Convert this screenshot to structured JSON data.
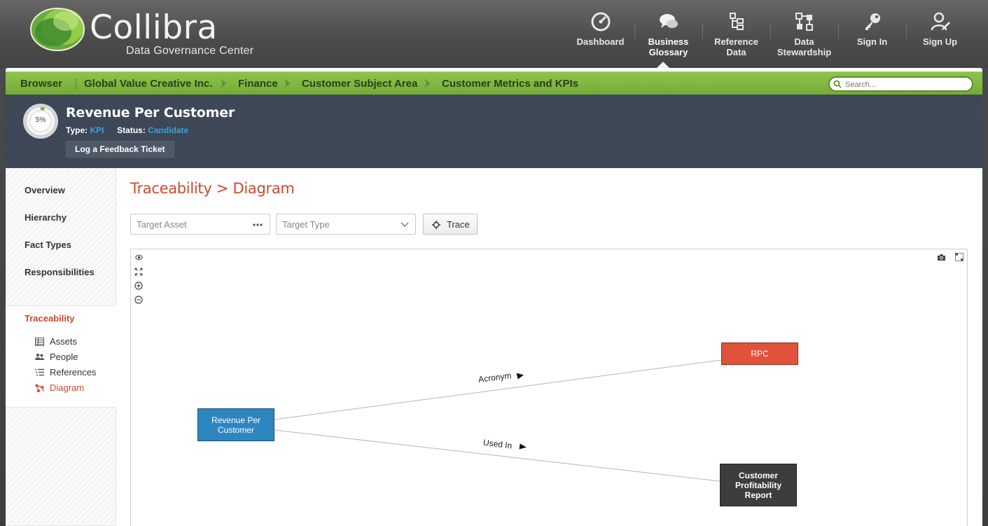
{
  "app": {
    "brand": "Collibra",
    "subtitle": "Data Governance Center"
  },
  "nav": {
    "items": [
      {
        "label_1": "Dashboard",
        "label_2": "",
        "icon": "dashboard-gauge-icon"
      },
      {
        "label_1": "Business",
        "label_2": "Glossary",
        "icon": "speech-bubbles-icon",
        "active": true
      },
      {
        "label_1": "Reference",
        "label_2": "Data",
        "icon": "reference-tree-icon"
      },
      {
        "label_1": "Data",
        "label_2": "Stewardship",
        "icon": "stewardship-icon"
      },
      {
        "label_1": "Sign In",
        "label_2": "",
        "icon": "key-icon"
      },
      {
        "label_1": "Sign Up",
        "label_2": "",
        "icon": "user-pen-icon"
      }
    ]
  },
  "breadcrumb": {
    "items": [
      "Browser",
      "Global Value Creative Inc.",
      "Finance",
      "Customer Subject Area",
      "Customer Metrics and KPIs"
    ],
    "search_placeholder": "Search..."
  },
  "asset": {
    "progress": "5%",
    "progress_fraction": 0.05,
    "title": "Revenue Per Customer",
    "type_label": "Type:",
    "type_value": "KPI",
    "status_label": "Status:",
    "status_value": "Candidate",
    "feedback_button": "Log a Feedback Ticket"
  },
  "sidebar": {
    "items": [
      "Overview",
      "Hierarchy",
      "Fact Types",
      "Responsibilities"
    ],
    "traceability": "Traceability",
    "sub_items": [
      {
        "label": "Assets",
        "icon": "table-icon"
      },
      {
        "label": "People",
        "icon": "people-icon"
      },
      {
        "label": "References",
        "icon": "list-icon"
      },
      {
        "label": "Diagram",
        "icon": "diagram-icon",
        "active": true
      }
    ]
  },
  "content": {
    "title": "Traceability > Diagram",
    "target_asset_placeholder": "Target Asset",
    "target_type_placeholder": "Target Type",
    "trace_button": "Trace"
  },
  "diagram": {
    "nodes": {
      "source_line1": "Revenue Per",
      "source_line2": "Customer",
      "rpc": "RPC",
      "report_line1": "Customer",
      "report_line2": "Profitability",
      "report_line3": "Report"
    },
    "edges": {
      "acronym": "Acronym",
      "used_in": "Used In"
    },
    "colors": {
      "source": "#2e86c1",
      "rpc": "#e0533a",
      "report": "#3d3d3d"
    }
  }
}
